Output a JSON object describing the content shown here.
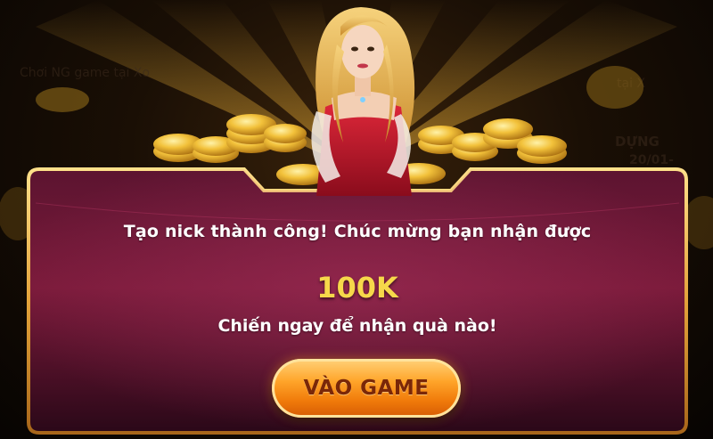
{
  "background": {
    "left_text": "Chơi NG game tại Xo",
    "right_text_1": "tại X",
    "right_text_2": "DỰNG",
    "right_text_3": "20/01-"
  },
  "dialog": {
    "message": "Tạo nick thành công! Chúc mừng bạn nhận được",
    "amount": "100K",
    "call_to_action": "Chiến ngay để nhận quà nào!",
    "play_button": "VÀO GAME"
  },
  "colors": {
    "panel_top": "#7a1a3a",
    "panel_bottom": "#2a0818",
    "frame_gold": "#f3c052",
    "amount_yellow": "#f6d84a",
    "button_orange": "#f07a0a",
    "button_text": "#7a2708"
  },
  "icons": [
    "gold-coin-icon",
    "hostess-illustration"
  ]
}
